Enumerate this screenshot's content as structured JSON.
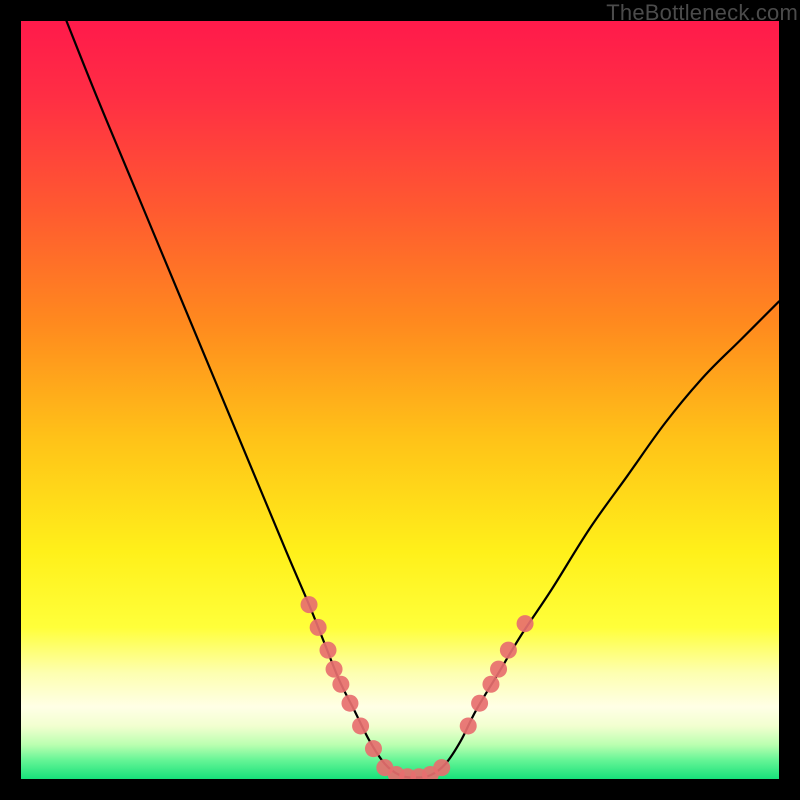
{
  "watermark": "TheBottleneck.com",
  "gradient": {
    "stops": [
      {
        "offset": 0.0,
        "color": "#ff1a4b"
      },
      {
        "offset": 0.1,
        "color": "#ff2e44"
      },
      {
        "offset": 0.25,
        "color": "#ff5a30"
      },
      {
        "offset": 0.4,
        "color": "#ff8a1e"
      },
      {
        "offset": 0.55,
        "color": "#ffc218"
      },
      {
        "offset": 0.7,
        "color": "#fff01a"
      },
      {
        "offset": 0.8,
        "color": "#ffff3a"
      },
      {
        "offset": 0.86,
        "color": "#fdffb0"
      },
      {
        "offset": 0.905,
        "color": "#ffffe6"
      },
      {
        "offset": 0.93,
        "color": "#f2ffd0"
      },
      {
        "offset": 0.955,
        "color": "#baffb0"
      },
      {
        "offset": 0.975,
        "color": "#66f596"
      },
      {
        "offset": 1.0,
        "color": "#17e07a"
      }
    ]
  },
  "chart_data": {
    "type": "line",
    "title": "",
    "xlabel": "",
    "ylabel": "",
    "x_range": [
      0,
      100
    ],
    "y_range": [
      0,
      100
    ],
    "note": "V-shaped bottleneck curve; minimum (0% bottleneck) near x≈48–55, rising steeply to each side. Values estimated from plot pixels.",
    "series": [
      {
        "name": "bottleneck-curve",
        "x": [
          6,
          10,
          15,
          20,
          25,
          30,
          35,
          38,
          40,
          42,
          44,
          46,
          48,
          50,
          52,
          54,
          56,
          58,
          60,
          63,
          66,
          70,
          75,
          80,
          85,
          90,
          95,
          100
        ],
        "y": [
          100,
          90,
          78,
          66,
          54,
          42,
          30,
          23,
          18,
          13,
          9,
          5,
          2,
          0.5,
          0.2,
          0.5,
          2,
          5,
          9,
          14,
          19,
          25,
          33,
          40,
          47,
          53,
          58,
          63
        ]
      }
    ],
    "markers": {
      "name": "highlighted-points",
      "color": "#e76f6f",
      "points": [
        {
          "x": 38.0,
          "y": 23.0
        },
        {
          "x": 39.2,
          "y": 20.0
        },
        {
          "x": 40.5,
          "y": 17.0
        },
        {
          "x": 41.3,
          "y": 14.5
        },
        {
          "x": 42.2,
          "y": 12.5
        },
        {
          "x": 43.4,
          "y": 10.0
        },
        {
          "x": 44.8,
          "y": 7.0
        },
        {
          "x": 46.5,
          "y": 4.0
        },
        {
          "x": 48.0,
          "y": 1.5
        },
        {
          "x": 49.5,
          "y": 0.6
        },
        {
          "x": 51.0,
          "y": 0.3
        },
        {
          "x": 52.5,
          "y": 0.3
        },
        {
          "x": 54.0,
          "y": 0.6
        },
        {
          "x": 55.5,
          "y": 1.5
        },
        {
          "x": 59.0,
          "y": 7.0
        },
        {
          "x": 60.5,
          "y": 10.0
        },
        {
          "x": 62.0,
          "y": 12.5
        },
        {
          "x": 63.0,
          "y": 14.5
        },
        {
          "x": 64.3,
          "y": 17.0
        },
        {
          "x": 66.5,
          "y": 20.5
        }
      ]
    }
  }
}
